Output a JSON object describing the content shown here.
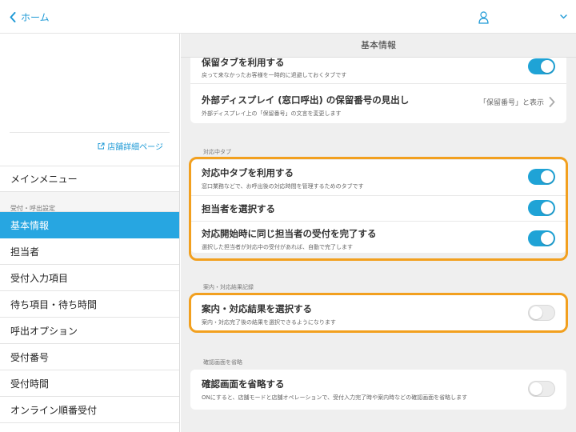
{
  "header": {
    "back_label": "ホーム"
  },
  "sidebar": {
    "store_link": "店舗詳細ページ",
    "main_menu": "メインメニュー",
    "section_label": "受付・呼出設定",
    "items": [
      {
        "label": "基本情報",
        "active": true
      },
      {
        "label": "担当者"
      },
      {
        "label": "受付入力項目"
      },
      {
        "label": "待ち項目・待ち時間"
      },
      {
        "label": "呼出オプション"
      },
      {
        "label": "受付番号"
      },
      {
        "label": "受付時間"
      },
      {
        "label": "オンライン順番受付"
      }
    ]
  },
  "main": {
    "page_title": "基本情報",
    "card1": {
      "row1": {
        "title": "保留タブを利用する",
        "desc": "戻って来なかったお客様を一時的に退避しておくタブです",
        "toggle": "on"
      },
      "row2": {
        "title": "外部ディスプレイ (窓口呼出) の保留番号の見出し",
        "desc": "外部ディスプレイ上の「保留番号」の文言を変更します",
        "value": "「保留番号」と表示"
      }
    },
    "section_inprogress": {
      "label": "対応中タブ",
      "rows": [
        {
          "title": "対応中タブを利用する",
          "desc": "窓口業務などで、お呼出後の対応時間を管理するためのタブです",
          "toggle": "on"
        },
        {
          "title": "担当者を選択する",
          "toggle": "on"
        },
        {
          "title": "対応開始時に同じ担当者の受付を完了する",
          "desc": "選択した担当者が対応中の受付があれば、自動で完了します",
          "toggle": "on"
        }
      ]
    },
    "section_guide": {
      "label": "案内・対応結果記録",
      "row": {
        "title": "案内・対応結果を選択する",
        "desc": "案内・対応完了後の結果を選択できるようになります",
        "toggle": "off"
      }
    },
    "section_confirm": {
      "label": "確認画面を省略",
      "row": {
        "title": "確認画面を省略する",
        "desc": "ONにすると、店舗モードと店舗オペレーションで、受付入力完了時や案内時などの確認画面を省略します",
        "toggle": "off"
      }
    }
  },
  "colors": {
    "accent": "#1fa3d6",
    "sidebar_active": "#27a6e1",
    "highlight": "#f2a01f"
  }
}
